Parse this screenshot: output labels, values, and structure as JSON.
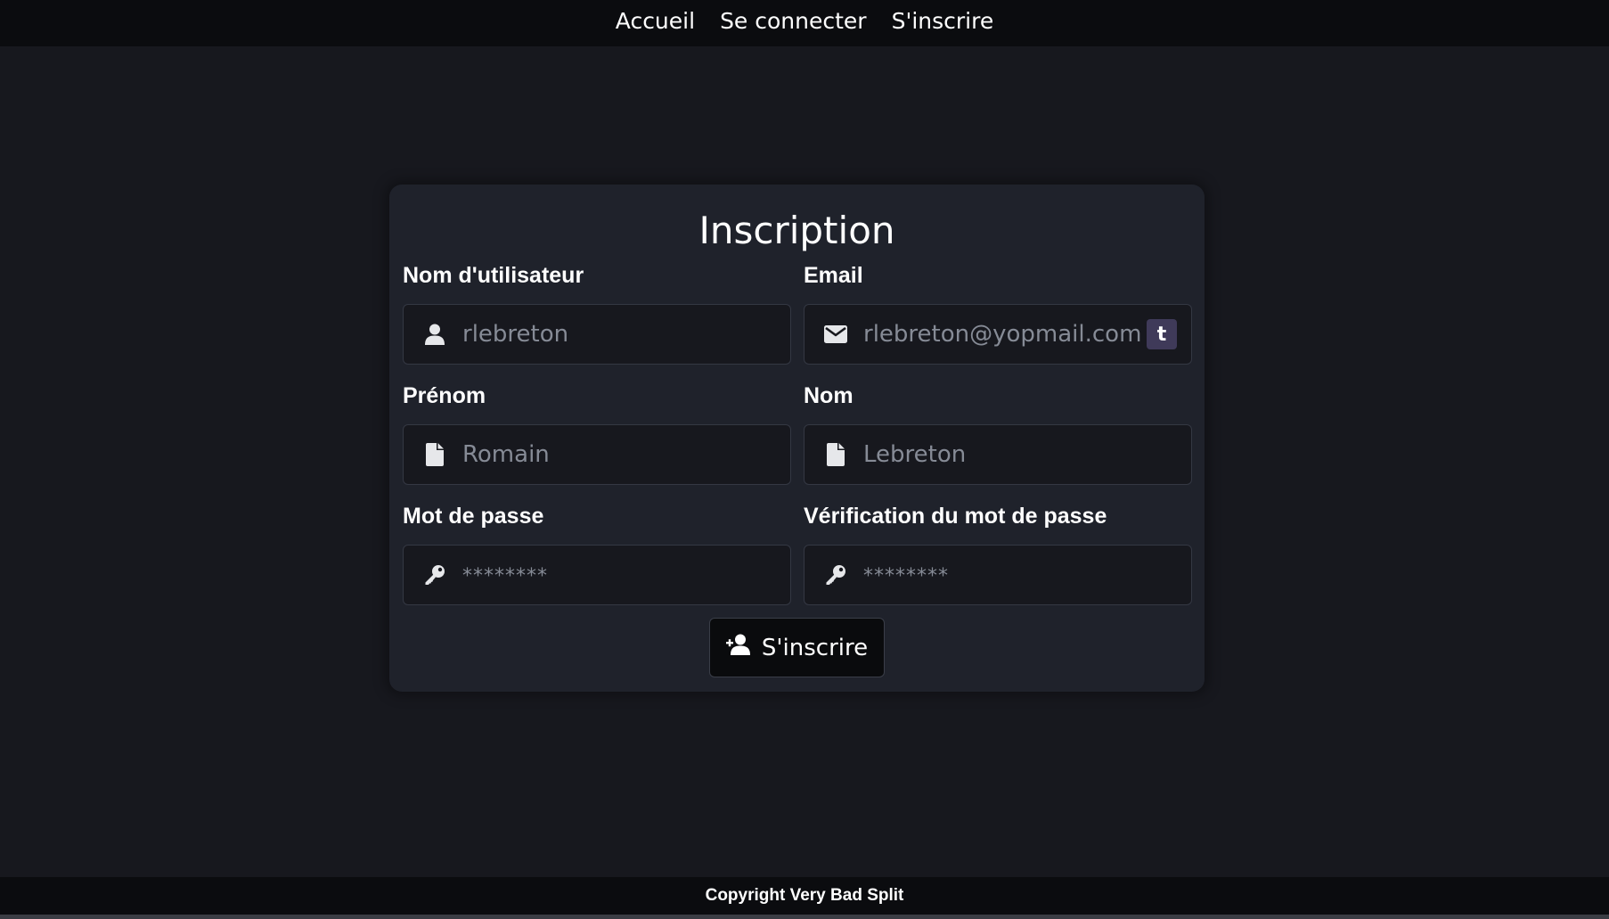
{
  "nav": {
    "items": [
      "Accueil",
      "Se connecter",
      "S'inscrire"
    ]
  },
  "form": {
    "title": "Inscription",
    "username": {
      "label": "Nom d'utilisateur",
      "placeholder": "rlebreton",
      "icon": "user-icon"
    },
    "email": {
      "label": "Email",
      "placeholder": "rlebreton@yopmail.com",
      "icon": "envelope-icon",
      "badge": "t"
    },
    "firstname": {
      "label": "Prénom",
      "placeholder": "Romain",
      "icon": "file-icon"
    },
    "lastname": {
      "label": "Nom",
      "placeholder": "Lebreton",
      "icon": "file-icon"
    },
    "password": {
      "label": "Mot de passe",
      "placeholder": "********",
      "icon": "key-icon"
    },
    "password_confirm": {
      "label": "Vérification du mot de passe",
      "placeholder": "********",
      "icon": "key-icon"
    },
    "submit": {
      "label": "S'inscrire",
      "icon": "user-plus-icon"
    }
  },
  "footer": {
    "text": "Copyright Very Bad Split"
  },
  "colors": {
    "background": "#17181e",
    "card": "#1f222b",
    "nav": "#0b0c0f",
    "input_bg": "#17181e",
    "badge": "#3f3a59"
  }
}
